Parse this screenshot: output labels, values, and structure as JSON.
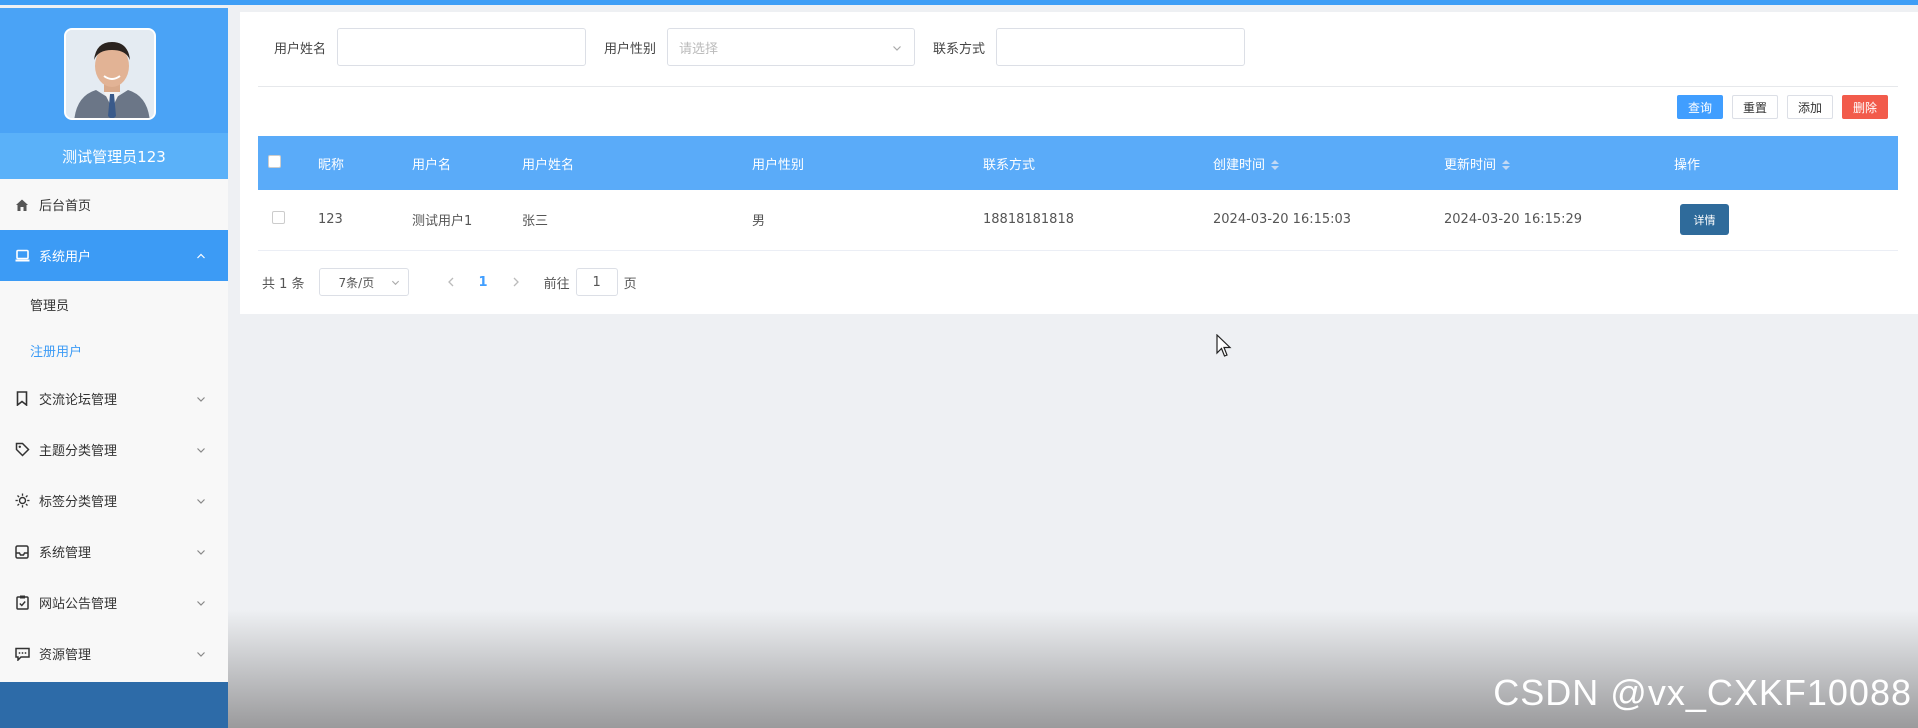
{
  "sidebar": {
    "user_name": "测试管理员123",
    "items": [
      {
        "label": "后台首页",
        "icon": "home-icon"
      },
      {
        "label": "系统用户",
        "icon": "laptop-icon",
        "active": true
      },
      {
        "label": "交流论坛管理",
        "icon": "bookmark-icon"
      },
      {
        "label": "主题分类管理",
        "icon": "tag-icon"
      },
      {
        "label": "标签分类管理",
        "icon": "sun-icon"
      },
      {
        "label": "系统管理",
        "icon": "inbox-icon"
      },
      {
        "label": "网站公告管理",
        "icon": "clipboard-icon"
      },
      {
        "label": "资源管理",
        "icon": "message-icon"
      }
    ],
    "sub_items": [
      {
        "label": "管理员"
      },
      {
        "label": "注册用户",
        "current": true
      }
    ]
  },
  "search": {
    "name_label": "用户姓名",
    "gender_label": "用户性别",
    "gender_placeholder": "请选择",
    "contact_label": "联系方式"
  },
  "actions": {
    "query": "查询",
    "reset": "重置",
    "add": "添加",
    "delete": "删除"
  },
  "table": {
    "columns": [
      "昵称",
      "用户名",
      "用户姓名",
      "用户性别",
      "联系方式",
      "创建时间",
      "更新时间",
      "操作"
    ],
    "rows": [
      {
        "nickname": "123",
        "username": "测试用户1",
        "realname": "张三",
        "gender": "男",
        "contact": "18818181818",
        "created": "2024-03-20 16:15:03",
        "updated": "2024-03-20 16:15:29",
        "action": "详情"
      }
    ]
  },
  "pager": {
    "total": "共 1 条",
    "page_size": "7条/页",
    "current_page": "1",
    "goto_prefix": "前往",
    "goto_value": "1",
    "goto_suffix": "页"
  },
  "watermark": "CSDN @vx_CXKF10088",
  "colors": {
    "accent": "#3c9bf5",
    "table_header": "#5aabf9",
    "danger": "#f25b4b"
  }
}
